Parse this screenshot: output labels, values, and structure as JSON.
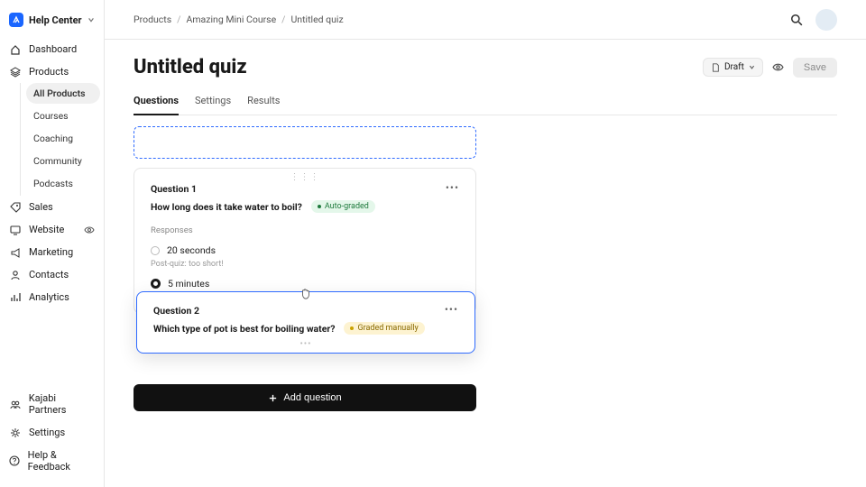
{
  "brand": {
    "name": "Help Center"
  },
  "nav": {
    "dashboard": "Dashboard",
    "products": "Products",
    "products_sub": {
      "all": "All Products",
      "courses": "Courses",
      "coaching": "Coaching",
      "community": "Community",
      "podcasts": "Podcasts"
    },
    "sales": "Sales",
    "website": "Website",
    "marketing": "Marketing",
    "contacts": "Contacts",
    "analytics": "Analytics",
    "partners": "Kajabi Partners",
    "settings": "Settings",
    "help": "Help & Feedback"
  },
  "breadcrumb": {
    "a": "Products",
    "b": "Amazing Mini Course",
    "c": "Untitled quiz"
  },
  "page": {
    "title": "Untitled quiz"
  },
  "actions": {
    "draft": "Draft",
    "save": "Save"
  },
  "tabs": {
    "questions": "Questions",
    "settings": "Settings",
    "results": "Results"
  },
  "q1": {
    "label": "Question 1",
    "text": "How long does it take water to boil?",
    "badge": "Auto-graded",
    "responses_label": "Responses",
    "r1": "20 seconds",
    "fb1": "Post-quiz: too short!",
    "r2": "5 minutes"
  },
  "q2": {
    "label": "Question 2",
    "text": "Which type of pot is best for boiling water?",
    "badge": "Graded manually"
  },
  "add_question": "Add question"
}
